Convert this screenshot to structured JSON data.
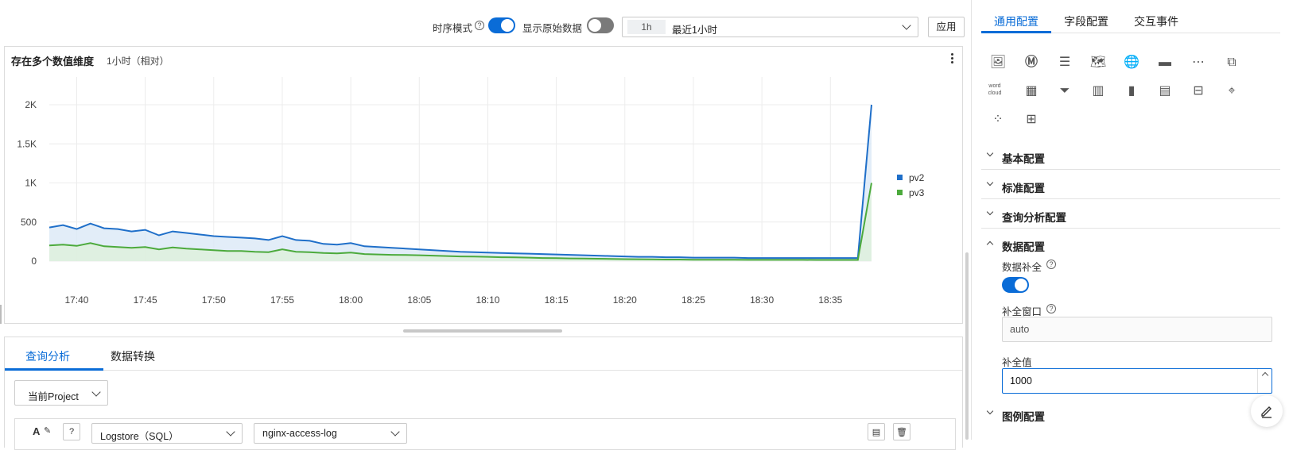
{
  "toolbar": {
    "timeseries_label": "时序模式",
    "raw_data_label": "显示原始数据",
    "time_tag": "1h",
    "time_range": "最近1小时",
    "apply_label": "应用"
  },
  "chart_panel": {
    "title": "存在多个数值维度",
    "subtitle": "1小时（相对）"
  },
  "chart_data": {
    "type": "area",
    "x": [
      "17:38",
      "17:39",
      "17:40",
      "17:41",
      "17:42",
      "17:43",
      "17:44",
      "17:45",
      "17:46",
      "17:47",
      "17:48",
      "17:49",
      "17:50",
      "17:51",
      "17:52",
      "17:53",
      "17:54",
      "17:55",
      "17:56",
      "17:57",
      "17:58",
      "17:59",
      "18:00",
      "18:01",
      "18:02",
      "18:03",
      "18:04",
      "18:05",
      "18:06",
      "18:07",
      "18:08",
      "18:09",
      "18:10",
      "18:11",
      "18:12",
      "18:13",
      "18:14",
      "18:15",
      "18:16",
      "18:17",
      "18:18",
      "18:19",
      "18:20",
      "18:21",
      "18:22",
      "18:23",
      "18:24",
      "18:25",
      "18:26",
      "18:27",
      "18:28",
      "18:29",
      "18:30",
      "18:31",
      "18:32",
      "18:33",
      "18:34",
      "18:35",
      "18:36",
      "18:37",
      "18:38"
    ],
    "xticks": [
      "17:40",
      "17:45",
      "17:50",
      "17:55",
      "18:00",
      "18:05",
      "18:10",
      "18:15",
      "18:20",
      "18:25",
      "18:30",
      "18:35"
    ],
    "yticks": [
      "0",
      "500",
      "1K",
      "1.5K",
      "2K"
    ],
    "ylim": [
      0,
      2000
    ],
    "series": [
      {
        "name": "pv2",
        "color": "#1f6fc9",
        "fill": "#dbe8f6",
        "values": [
          430,
          460,
          410,
          480,
          420,
          410,
          380,
          400,
          330,
          380,
          360,
          340,
          320,
          310,
          300,
          290,
          270,
          320,
          270,
          260,
          220,
          210,
          230,
          190,
          180,
          170,
          160,
          150,
          140,
          130,
          120,
          115,
          110,
          105,
          100,
          95,
          90,
          85,
          80,
          75,
          70,
          65,
          60,
          55,
          55,
          50,
          50,
          45,
          45,
          45,
          45,
          40,
          40,
          40,
          40,
          40,
          40,
          40,
          40,
          40,
          2000
        ]
      },
      {
        "name": "pv3",
        "color": "#4caa3c",
        "fill": "#dff0db",
        "values": [
          200,
          210,
          195,
          230,
          190,
          180,
          170,
          180,
          150,
          175,
          160,
          150,
          140,
          130,
          130,
          120,
          115,
          150,
          120,
          115,
          105,
          100,
          110,
          90,
          85,
          80,
          78,
          75,
          70,
          65,
          60,
          58,
          55,
          50,
          48,
          45,
          40,
          38,
          35,
          33,
          30,
          28,
          25,
          24,
          22,
          20,
          20,
          18,
          18,
          18,
          18,
          16,
          16,
          16,
          16,
          16,
          15,
          15,
          15,
          15,
          1000
        ]
      }
    ]
  },
  "bottom_tabs": [
    "查询分析",
    "数据转换"
  ],
  "project_select": "当前Project",
  "query_bar": {
    "store_type": "Logstore（SQL）",
    "logstore": "nginx-access-log"
  },
  "right_tabs": [
    "通用配置",
    "字段配置",
    "交互事件"
  ],
  "sections": {
    "basic": "基本配置",
    "standard": "标准配置",
    "query": "查询分析配置",
    "data": "数据配置",
    "legend": "图例配置"
  },
  "data_config": {
    "fill_label": "数据补全",
    "window_label": "补全窗口",
    "window_value": "auto",
    "value_label": "补全值",
    "value": "1000"
  },
  "chart_icons_wordcloud": "word cloud"
}
